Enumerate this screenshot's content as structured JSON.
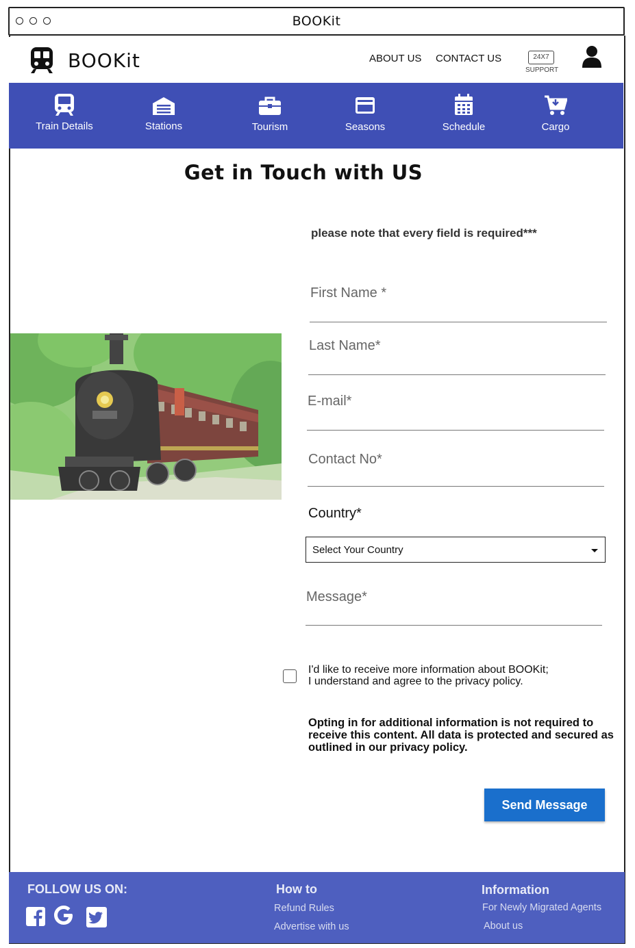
{
  "window": {
    "title": "BOOKit"
  },
  "header": {
    "logo_text": "BOOKit",
    "links": [
      "ABOUT US",
      "CONTACT US"
    ],
    "support_badge": "24X7",
    "support_label": "SUPPORT"
  },
  "nav": [
    {
      "label": "Train Details",
      "icon": "train-icon"
    },
    {
      "label": "Stations",
      "icon": "station-icon"
    },
    {
      "label": "Tourism",
      "icon": "briefcase-icon"
    },
    {
      "label": "Seasons",
      "icon": "credit-card-icon"
    },
    {
      "label": "Schedule",
      "icon": "calendar-icon"
    },
    {
      "label": "Cargo",
      "icon": "cart-icon"
    }
  ],
  "page": {
    "title": "Get in Touch with US"
  },
  "form": {
    "note": "please note that every field is required***",
    "fields": [
      "First Name *",
      "Last Name*",
      "E-mail*",
      "Contact No*"
    ],
    "country_label": "Country*",
    "country_select": "Select Your Country",
    "message_label": "Message*",
    "consent_line1": "I'd like to receive more information about  BOOKit;",
    "consent_line2": "I understand and agree to the privacy policy.",
    "disclaimer": "Opting in for additional information is not required to receive this content. All data is protected and secured as outlined in our privacy policy.",
    "submit": "Send Message"
  },
  "footer": {
    "follow": "FOLLOW US ON:",
    "socials": [
      "facebook-icon",
      "google-icon",
      "twitter-icon"
    ],
    "howto_heading": "How to",
    "howto_links": [
      "Refund Rules",
      "Advertise with us"
    ],
    "info_heading": "Information",
    "info_links": [
      "For Newly Migrated Agents",
      "About us"
    ]
  },
  "colors": {
    "nav": "#3f4fb5",
    "footer": "#4e5fbf",
    "button": "#1a6fcc"
  }
}
